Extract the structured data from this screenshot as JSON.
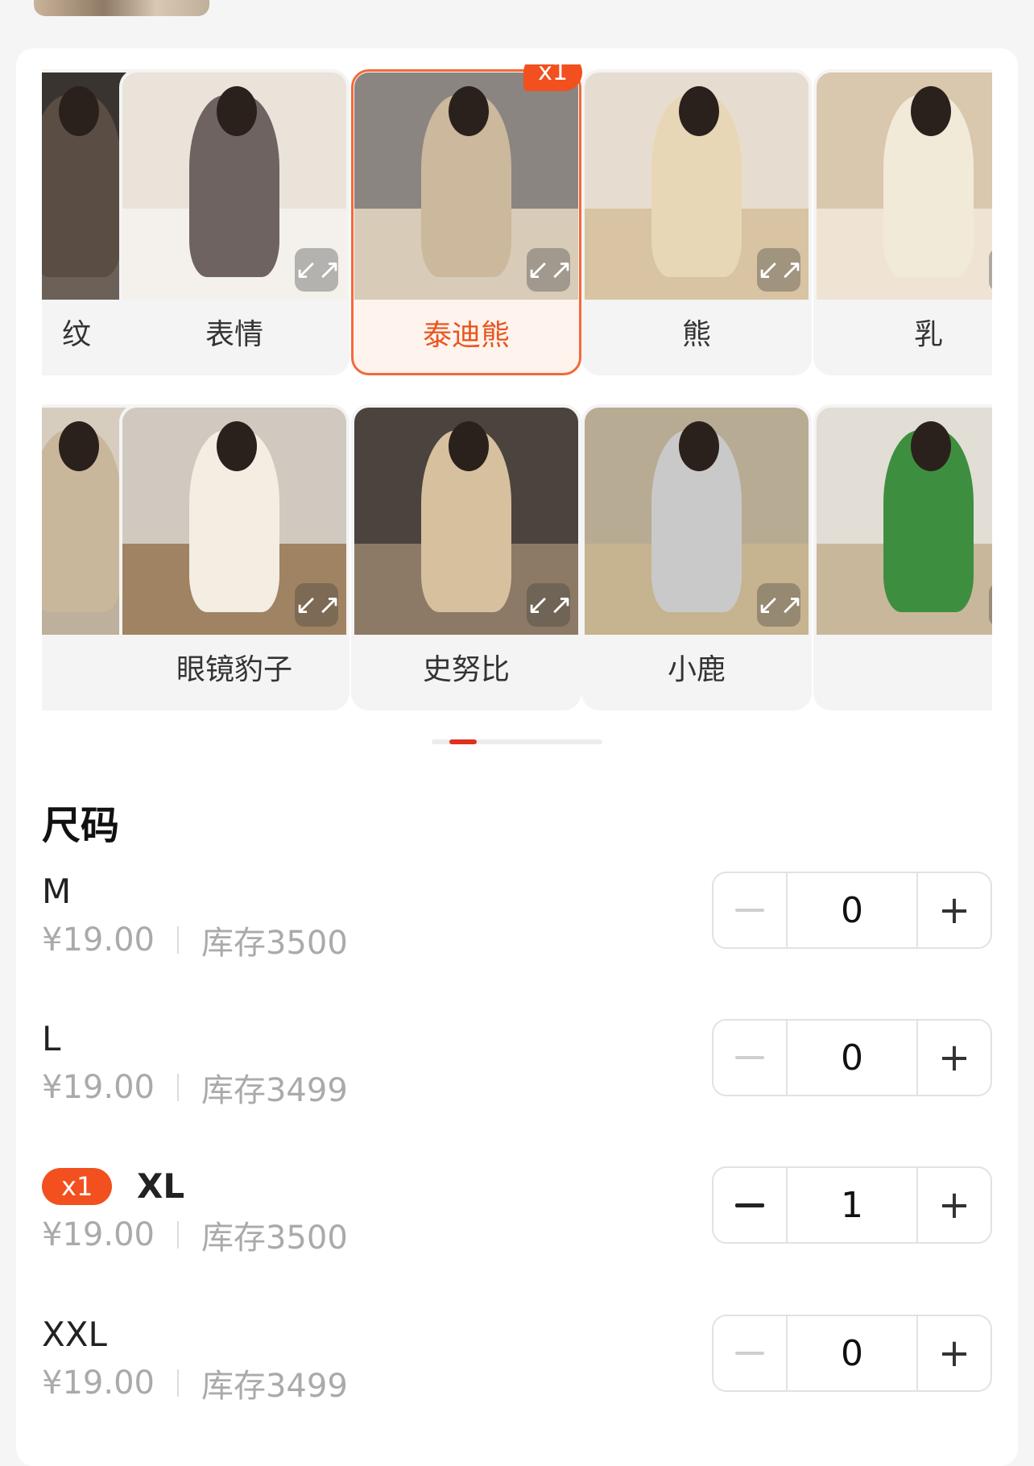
{
  "variants": {
    "row1": [
      {
        "label": "纹",
        "bg": "#3a3430",
        "floor": "#6b6158",
        "shirt": "#5a4d44"
      },
      {
        "label": "表情",
        "bg": "#e9e3da",
        "floor": "#f4f1ec",
        "shirt": "#6e6360"
      },
      {
        "label": "泰迪熊",
        "bg": "#8a8580",
        "floor": "#d8cbb8",
        "shirt": "#cbb89d",
        "selected": true,
        "badge": "x1"
      },
      {
        "label": "熊",
        "bg": "#e6ddd0",
        "floor": "#d8c3a2",
        "shirt": "#e8d7b6"
      },
      {
        "label": "乳",
        "bg": "#d9c7ae",
        "floor": "#efe4d4",
        "shirt": "#f2ead8"
      }
    ],
    "row2": [
      {
        "label": "",
        "bg": "#d6cdbf",
        "floor": "#bdb09c",
        "shirt": "#c9b79c"
      },
      {
        "label": "眼镜豹子",
        "bg": "#cfc9c0",
        "floor": "#a08362",
        "shirt": "#f3ede2"
      },
      {
        "label": "史努比",
        "bg": "#4a433e",
        "floor": "#8c7a66",
        "shirt": "#d6c09e"
      },
      {
        "label": "小鹿",
        "bg": "#b8ab94",
        "floor": "#c6b38f",
        "shirt": "#c9c9c9"
      },
      {
        "label": "",
        "bg": "#e2ddd5",
        "floor": "#c9b79c",
        "shirt": "#3d8f3f"
      }
    ]
  },
  "expand_icon": "↙↗",
  "section_title": "尺码",
  "sizes": [
    {
      "name": "M",
      "price": "¥19.00",
      "stock": "库存3500",
      "qty": "0",
      "bold": false
    },
    {
      "name": "L",
      "price": "¥19.00",
      "stock": "库存3499",
      "qty": "0",
      "bold": false
    },
    {
      "name": "XL",
      "price": "¥19.00",
      "stock": "库存3500",
      "qty": "1",
      "bold": true,
      "badge": "x1"
    },
    {
      "name": "XXL",
      "price": "¥19.00",
      "stock": "库存3499",
      "qty": "0",
      "bold": false
    }
  ],
  "plus_label": "+",
  "colors": {
    "accent": "#f2501e",
    "indicator": "#e0301e"
  }
}
